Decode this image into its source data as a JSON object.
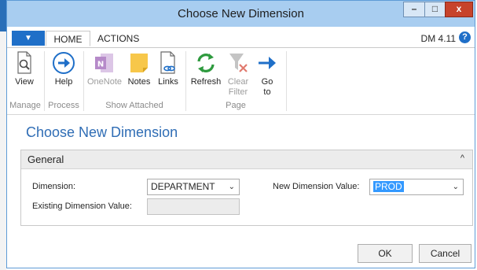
{
  "window": {
    "title": "Choose New Dimension",
    "controls": {
      "minimize": "–",
      "maximize": "□",
      "close": "x"
    }
  },
  "ribbon_tabs": {
    "menu_glyph": "▼",
    "home": "HOME",
    "actions": "ACTIONS",
    "version": "DM 4.11",
    "help_glyph": "?"
  },
  "ribbon": {
    "groups": {
      "manage": "Manage",
      "process": "Process",
      "show_attached": "Show Attached",
      "page": "Page"
    },
    "buttons": {
      "view": "View",
      "help": "Help",
      "onenote": "OneNote",
      "notes": "Notes",
      "links": "Links",
      "refresh": "Refresh",
      "clear_filter": "Clear Filter",
      "go_to": "Go to"
    }
  },
  "content": {
    "title": "Choose New Dimension",
    "fasttab": {
      "title": "General",
      "collapse_glyph": "^"
    },
    "fields": {
      "dimension_label": "Dimension:",
      "dimension_value": "DEPARTMENT",
      "existing_label": "Existing Dimension Value:",
      "existing_value": "",
      "new_label": "New Dimension Value:",
      "new_value": "PROD"
    }
  },
  "footer": {
    "ok": "OK",
    "cancel": "Cancel"
  },
  "colors": {
    "titlebar": "#a8cdf0",
    "accent": "#1f6fc8",
    "heading": "#2f6db5",
    "close_button": "#c7432b"
  }
}
